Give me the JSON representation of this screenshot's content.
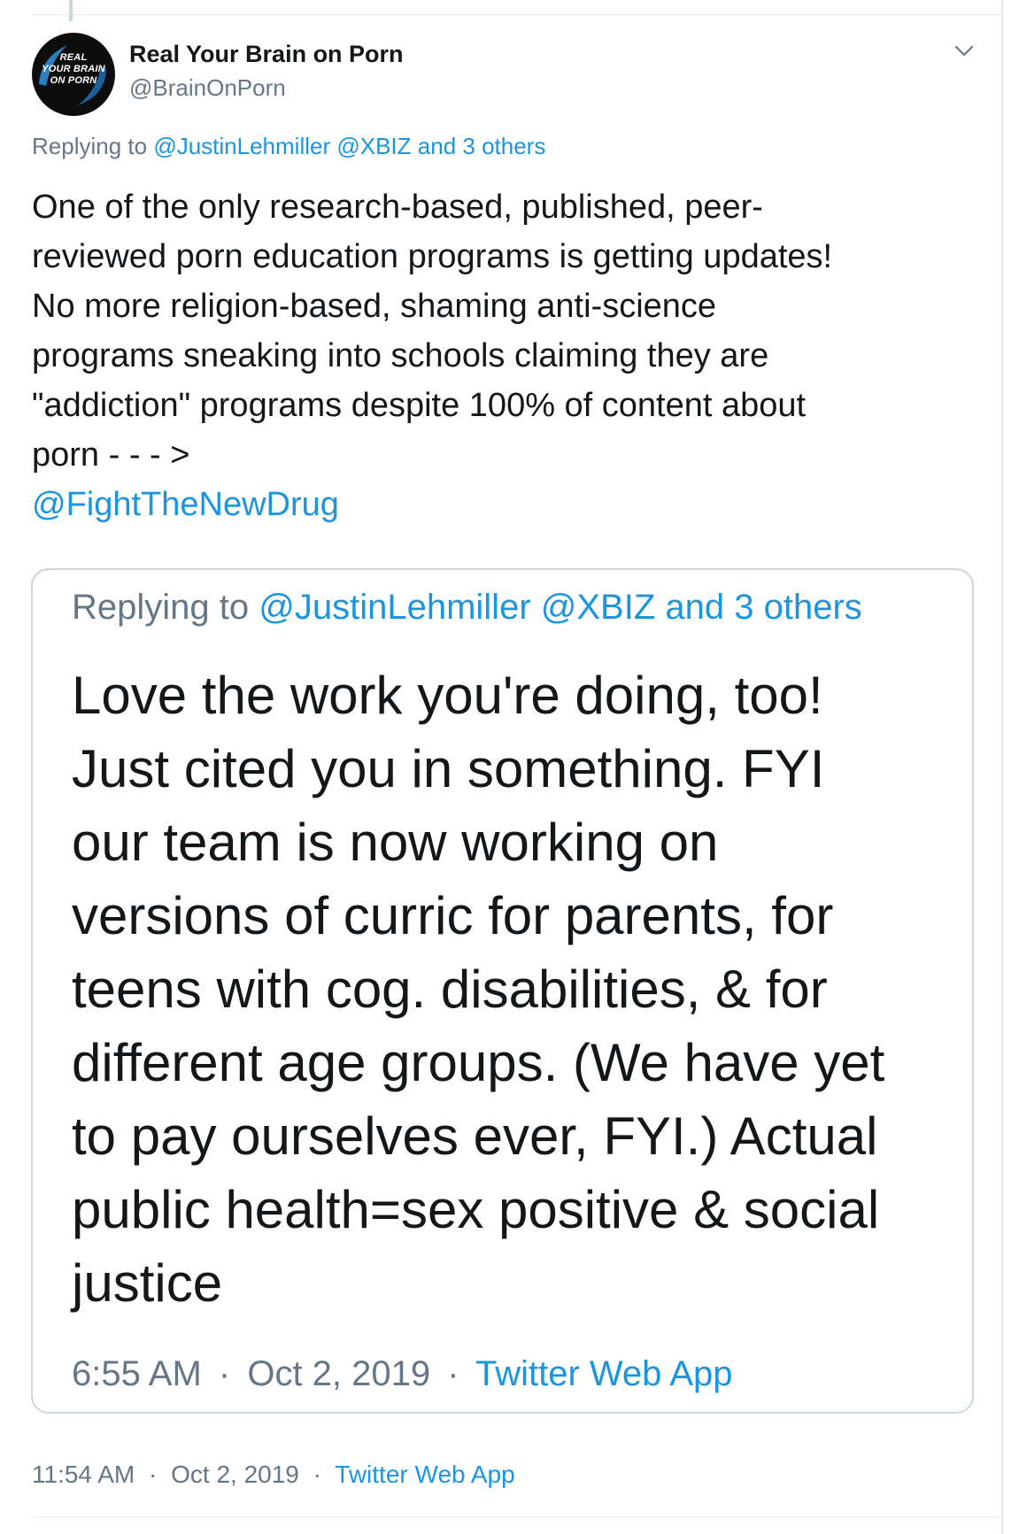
{
  "author": {
    "display_name": "Real Your Brain on Porn",
    "handle": "@BrainOnPorn",
    "avatar_lines": [
      "REAL",
      "YOUR BRAIN",
      "ON PORN"
    ]
  },
  "reply": {
    "prefix": "Replying to",
    "mention_1": "@JustinLehmiller",
    "mention_2": "@XBIZ",
    "and_others": "and 3 others"
  },
  "tweet": {
    "text": "One of the only research-based, published, peer-\nreviewed porn education programs is getting updates!\nNo more religion-based, shaming anti-science\nprograms sneaking into schools claiming they are\n\"addiction\" programs despite 100% of content about\nporn - - - >",
    "mention": "@FightTheNewDrug"
  },
  "quoted": {
    "reply_prefix": "Replying to",
    "mention_1": "@JustinLehmiller",
    "mention_2": "@XBIZ",
    "and_others": "and 3 others",
    "text": "Love the work you're doing, too!\nJust cited you in something. FYI\nour team is now working on\nversions of curric for parents, for\nteens with cog. disabilities, & for\ndifferent age groups. (We have yet\nto pay ourselves ever, FYI.) Actual\npublic health=sex positive & social\njustice",
    "time": "6:55 AM",
    "date": "Oct 2, 2019",
    "source": "Twitter Web App",
    "dot": "·"
  },
  "footer": {
    "time": "11:54 AM",
    "date": "Oct 2, 2019",
    "source": "Twitter Web App",
    "dot": "·"
  },
  "colors": {
    "link": "#1b95e0",
    "muted": "#657786",
    "text": "#14171a",
    "border": "#ccd6dd"
  },
  "icons": {
    "caret": "chevron-down-icon"
  }
}
